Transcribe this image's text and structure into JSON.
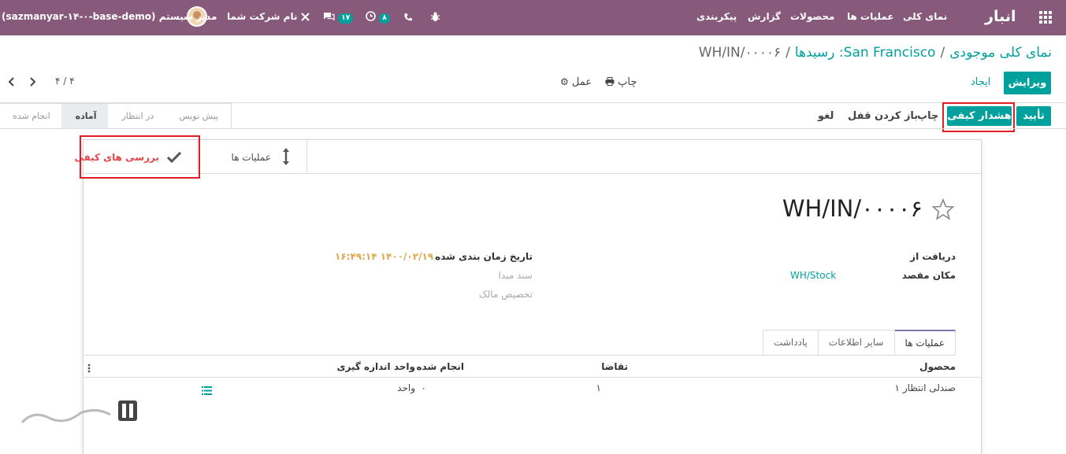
{
  "navbar": {
    "app_name": "انبار",
    "menu": [
      "نمای کلی",
      "عملیات ها",
      "محصولات",
      "گزارش",
      "پیکربندی"
    ],
    "company": "نام شرکت شما",
    "badge_activities": "۸",
    "badge_messages": "۱۷",
    "user": "مدیر سیستم (sazmanyar-۱۴-۰-base-demo)"
  },
  "breadcrumb": {
    "item1": "نمای کلی موجودی",
    "item2": "San Francisco: رسیدها",
    "current": "WH/IN/۰۰۰۰۶"
  },
  "control": {
    "edit": "ویرایش",
    "create": "ایجاد",
    "print": "چاپ",
    "action": "عمل",
    "pager": "۴ / ۴"
  },
  "header_buttons": {
    "validate": "تأیید",
    "quality_alert": "هشدار کیفی",
    "print": "چاپ",
    "unlock": "باز کردن قفل",
    "cancel": "لغو"
  },
  "stages": [
    "پیش نویس",
    "در انتظار",
    "آماده",
    "انجام شده"
  ],
  "active_stage": "آماده",
  "smart_buttons": {
    "operations": "عملیات ها",
    "quality_checks": "بررسی های کیفی"
  },
  "record": {
    "name": "WH/IN/۰۰۰۰۶",
    "receive_from_label": "دریافت از",
    "destination_label": "مکان مقصد",
    "destination_value": "WH/Stock",
    "scheduled_label": "تاریخ زمان بندی شده",
    "scheduled_value": "۱۴۰۰/۰۲/۱۹ ۱۶:۴۹:۱۴",
    "source_doc_label": "سند مبدا",
    "owner_label": "تخصیص مالک"
  },
  "tabs": [
    "عملیات ها",
    "سایر اطلاعات",
    "یادداشت"
  ],
  "table": {
    "headers": [
      "محصول",
      "تقاضا",
      "انجام شده",
      "واحد اندازه گیری"
    ],
    "rows": [
      {
        "product": "صندلی انتظار ۱",
        "demand": "۱",
        "done": "۰",
        "uom": "واحد"
      }
    ]
  },
  "colors": {
    "navbar": "#875a7b",
    "primary": "#00a09d",
    "highlight_box": "#e01d24",
    "date_value": "#e0a74a"
  }
}
